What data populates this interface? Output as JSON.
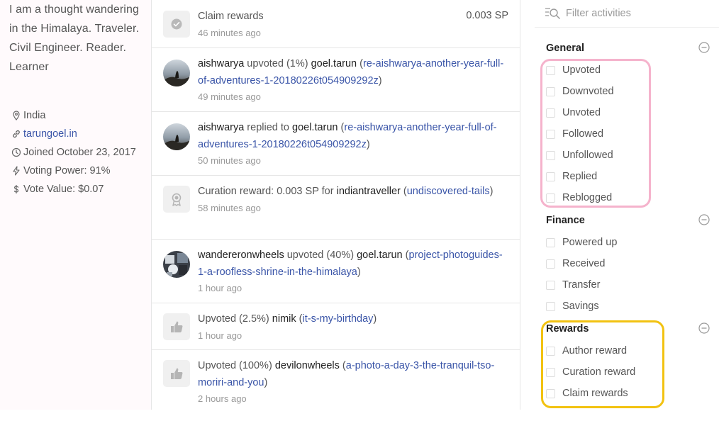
{
  "profile": {
    "bio": "I am a thought wandering in the Himalaya. Traveler. Civil Engineer. Reader. Learner",
    "location": "India",
    "website": "tarungoel.in",
    "joined": "Joined October 23, 2017",
    "voting_power": "Voting Power: 91%",
    "vote_value": "Vote Value: $0.07"
  },
  "feed": {
    "items": [
      {
        "kind": "claim",
        "text": "Claim rewards",
        "amount": "0.003 SP",
        "time": "46 minutes ago"
      },
      {
        "kind": "vote",
        "actor": "aishwarya",
        "action": " upvoted (1%) ",
        "target": "goel.tarun",
        "link": "re-aishwarya-another-year-full-of-adventures-1-20180226t054909292z",
        "time": "49 minutes ago"
      },
      {
        "kind": "reply",
        "actor": "aishwarya",
        "action": " replied to ",
        "target": "goel.tarun",
        "link": "re-aishwarya-another-year-full-of-adventures-1-20180226t054909292z",
        "time": "50 minutes ago"
      },
      {
        "kind": "curation",
        "prefix": "Curation reward: 0.003 SP for ",
        "target": "indiantraveller",
        "link": "undiscovered-tails",
        "time": "58 minutes ago"
      },
      {
        "kind": "vote",
        "actor": "wandereronwheels",
        "action": " upvoted (40%) ",
        "target": "goel.tarun",
        "link": "project-photoguides-1-a-roofless-shrine-in-the-himalaya",
        "time": "1 hour ago"
      },
      {
        "kind": "upvoted",
        "prefix": "Upvoted (2.5%) ",
        "target": "nimik",
        "link": "it-s-my-birthday",
        "time": "1 hour ago"
      },
      {
        "kind": "upvoted",
        "prefix": "Upvoted (100%) ",
        "target": "devilonwheels",
        "link": "a-photo-a-day-3-the-tranquil-tso-moriri-and-you",
        "time": "2 hours ago"
      }
    ]
  },
  "filters": {
    "placeholder": "Filter activities",
    "general_title": "General",
    "general": [
      "Upvoted",
      "Downvoted",
      "Unvoted",
      "Followed",
      "Unfollowed",
      "Replied",
      "Reblogged"
    ],
    "finance_title": "Finance",
    "finance": [
      "Powered up",
      "Received",
      "Transfer",
      "Savings"
    ],
    "rewards_title": "Rewards",
    "rewards": [
      "Author reward",
      "Curation reward",
      "Claim rewards"
    ]
  },
  "colors": {
    "link": "#3a55a8",
    "highlight_pink": "#f5b3cc",
    "highlight_yellow": "#f2c211"
  }
}
